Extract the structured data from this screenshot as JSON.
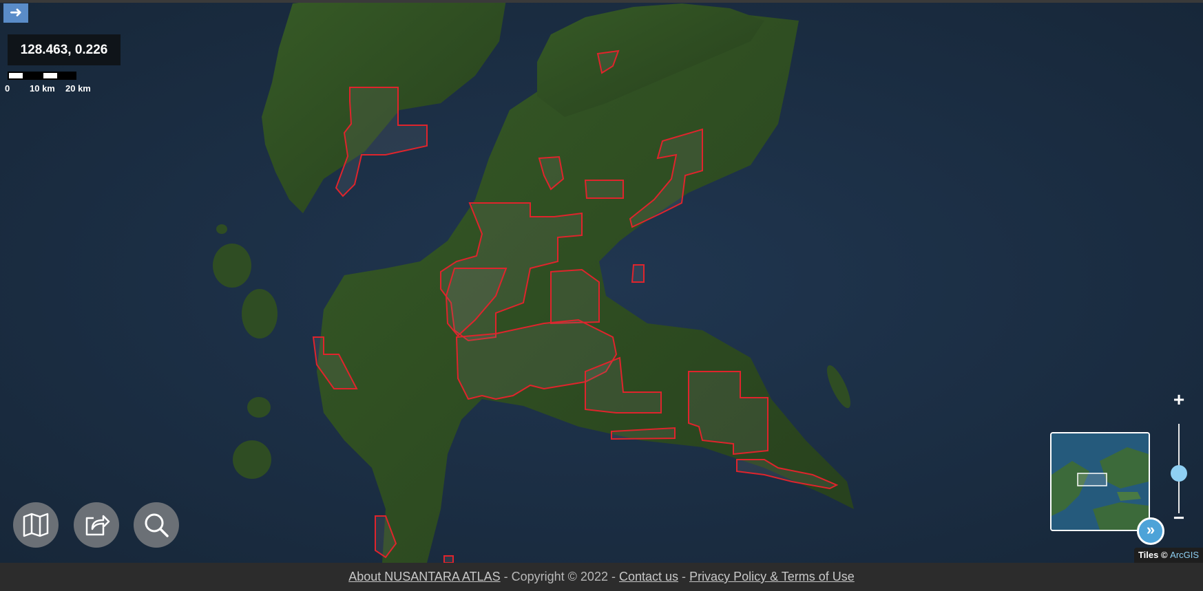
{
  "map": {
    "coordinates": "128.463, 0.226"
  },
  "scale": {
    "labels": [
      "0",
      "10 km",
      "20 km"
    ]
  },
  "controls": {
    "expand_icon": "arrow-right-icon",
    "zoom_in": "+",
    "zoom_out": "−",
    "minimap_toggle": "»",
    "zoom_level": 0.45
  },
  "buttons": [
    {
      "name": "basemap-button",
      "icon": "map-icon"
    },
    {
      "name": "share-button",
      "icon": "share-icon"
    },
    {
      "name": "search-button",
      "icon": "search-icon"
    }
  ],
  "attribution": {
    "prefix": "Tiles ©",
    "link": "ArcGIS"
  },
  "footer": {
    "about": "About NUSANTARA ATLAS",
    "copyright": "- Copyright ©   2022 -",
    "contact": "Contact us",
    "sep": "-",
    "privacy": "Privacy Policy & Terms of Use"
  },
  "colors": {
    "concession_outline": "#e0242c",
    "sea": "#1c3047",
    "land": "#2e4a22",
    "accent": "#8fd0f3"
  }
}
